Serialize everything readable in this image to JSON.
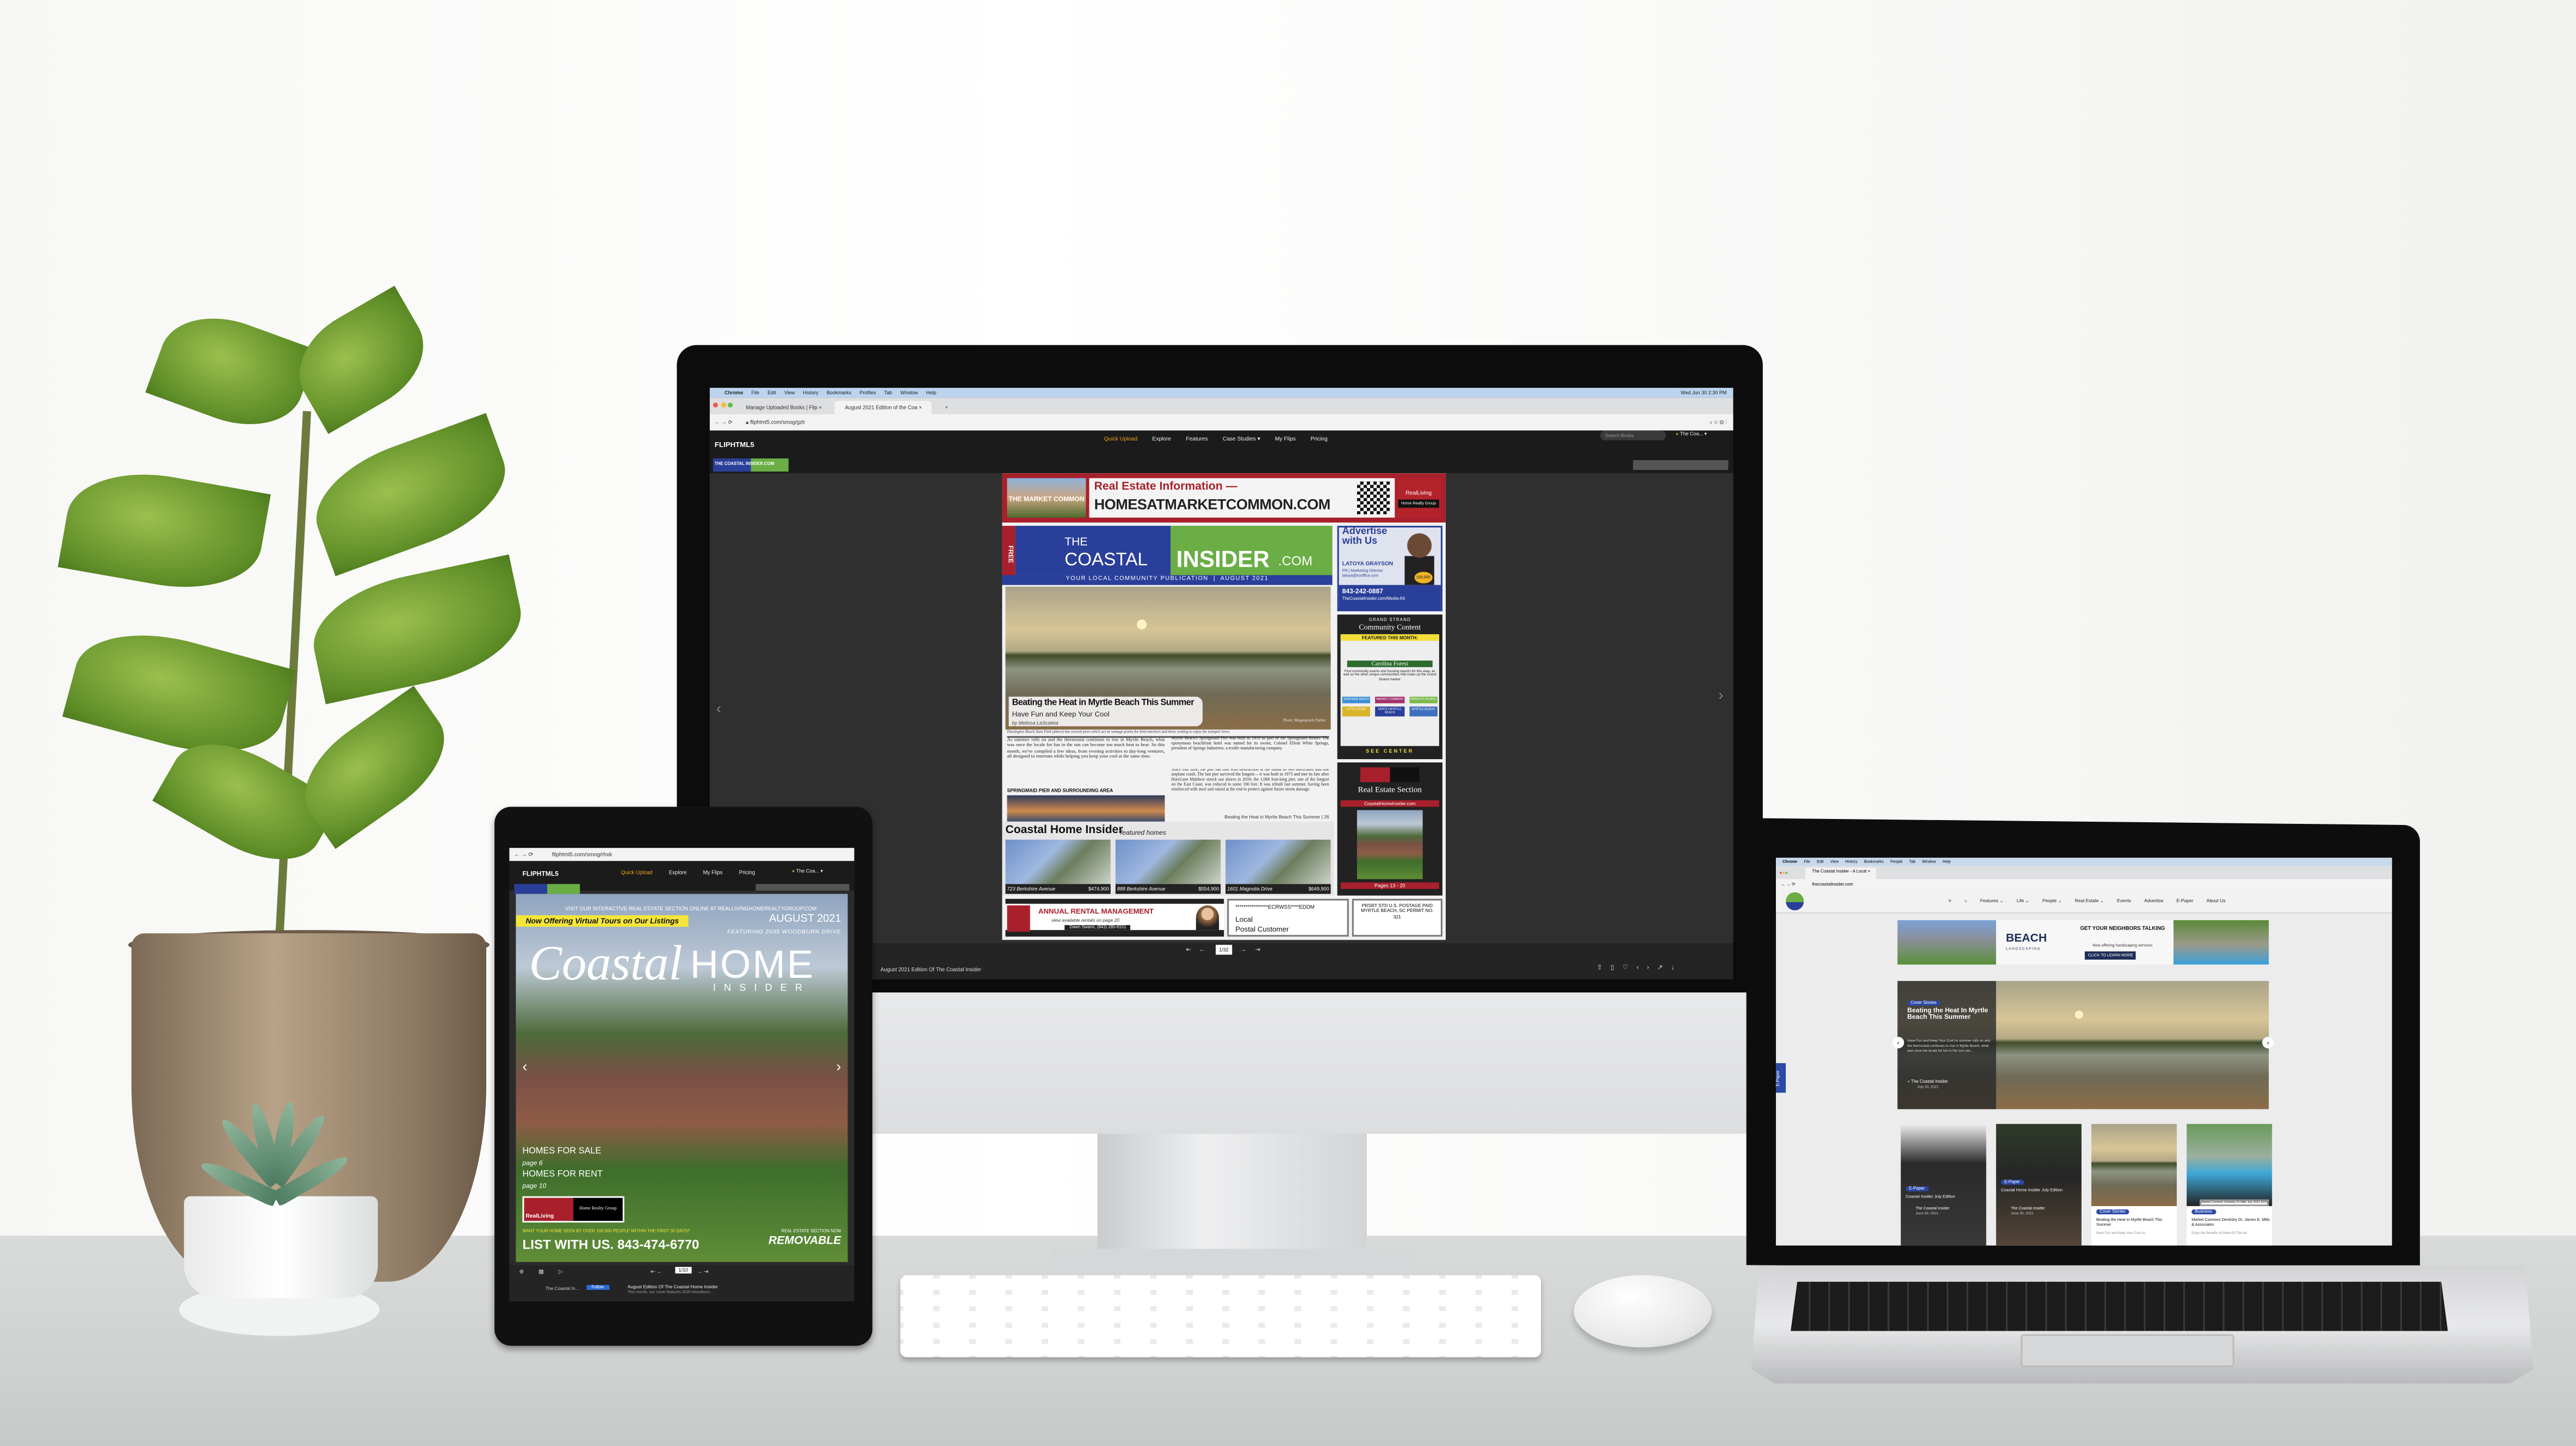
{
  "monitor": {
    "browser": {
      "menu": [
        "Chrome",
        "File",
        "Edit",
        "View",
        "History",
        "Bookmarks",
        "Profiles",
        "Tab",
        "Window",
        "Help"
      ],
      "clock": "Wed Jun 30 2:30 PM",
      "tabs": [
        "Manage Uploaded Books | Flip",
        "August 2021 Edition of the Coa"
      ],
      "url": "fliphtml5.com/smog/gzlr"
    },
    "site": {
      "logo": "FLIPHTML5",
      "nav": [
        "Quick Upload",
        "Explore",
        "Features",
        "Case Studies ▾",
        "My Flips",
        "Pricing"
      ],
      "search_placeholder": "Search Books",
      "user": "The Coa...",
      "brand_logo": "THE COASTAL INSIDER.COM"
    },
    "magazine": {
      "top_ad": {
        "logo": "THE MARKET COMMON",
        "line1": "Real Estate Information —",
        "line2": "HOMESATMARKETCOMMON.COM",
        "brand": "RealLiving",
        "brand_sub": "Home Realty Group"
      },
      "free": "FREE",
      "masthead_the": "THE",
      "masthead_coastal": "COASTAL",
      "masthead_insider": "INSIDER",
      "masthead_com": ".COM",
      "tagline": "YOUR LOCAL COMMUNITY PUBLICATION  |  AUGUST 2021",
      "advertise": {
        "title": "Advertise with Us",
        "name": "LATOYA GRAYSON",
        "role": "PR | Marketing Director",
        "email": "latoya@tcioffice.com",
        "phone": "843-242-0887",
        "url": "TheCoastalInsider.com/Media-Kit",
        "badge": "100,000"
      },
      "community": {
        "kicker": "GRAND STRAND",
        "title": "Community Content",
        "featured": "FEATURED THIS MONTH:",
        "area": "Carolina Forest",
        "desc": "Find community events and housing reports for this area, as well as the other unique communities that make up the Grand Strand market:",
        "towns": [
          "SURFSIDE BEACH",
          "MARKET COMMON",
          "PAWLEYS ISLAND",
          "LITTLE RIVER",
          "NORTH MYRTLE BEACH",
          "MYRTLE BEACH"
        ],
        "see": "SEE CENTER"
      },
      "re_section": {
        "title": "Real Estate Section",
        "url": "CoastalHomeInsider.com",
        "pages": "Pages 13 - 20"
      },
      "story": {
        "title": "Beating the Heat in Myrtle Beach This Summer",
        "subtitle": "Have Fun and Keep Your Cool",
        "byline": "by Melissa LaScaleia",
        "credit": "Photo: Meganpixels Parker",
        "caption": "Huntington Beach State Park (above) has several piers which act as vantage points for bird-watchers and those seeking to enjoy the tranquil views."
      },
      "col1": "As summer rolls on and the thermostat continues to rise in Myrtle Beach, what was once the locale for fun in the sun can become too much heat to bear. So this month, we've compiled a few ideas, from evening activities to day-long ventures, all designed to entertain while helping you keep your cool at the same time.",
      "sub_heading": "SPRINGMAID PIER AND SURROUNDING AREA",
      "col2a": "Myrtle Beach's Springmaid Pier was built in 1953 as part of the Springmaid Resort. The eponymous beachfront hotel was named for its owner, Colonel Elliott White Springs, president of Springs Industries, a textile manufacturing company.",
      "col2b": "Since that time, the pier has met with destruction at the hands of two hurricanes and one airplane crash. The last pier survived the longest— it was built in 1973 and met its fate after Hurricane Matthew struck our shores in 2016; the 1,068 foot-long pier, one of the longest on the East Coast, was reduced to some 100 feet. It was rebuilt last summer, having been reinforced with steel and raised at the end to protect against future storm damage.",
      "jump": "Beating the Heat in Myrtle Beach This Summer | 26",
      "homes_title": "Coastal Home Insider",
      "homes_sub": "featured homes",
      "homes": [
        {
          "address": "723 Berkshire Avenue",
          "price": "$474,900"
        },
        {
          "address": "888 Berkshire Avenue",
          "price": "$554,900"
        },
        {
          "address": "1601 Magnolia Drive",
          "price": "$649,900"
        }
      ],
      "rental": {
        "title": "ANNUAL RENTAL MANAGEMENT",
        "sub": "view available rentals on page 20",
        "contact": "Dawn Swann, (843) 285-6151"
      },
      "mailing": {
        "code": "****************ECRWSS****EDDM",
        "line1": "Local",
        "line2": "Postal Customer"
      },
      "postage": "PRSRT STD U.S. POSTAGE PAID MYRTLE BEACH, SC PERMIT NO. 321"
    },
    "viewer": {
      "page": "1/32",
      "title": "August 2021 Edition Of The Coastal Insider"
    }
  },
  "tablet": {
    "url": "fliphtml5.com/smog/rhxk",
    "logo": "FLIPHTML5",
    "nav": [
      "Quick Upload",
      "Explore",
      "My Flips",
      "Pricing"
    ],
    "user": "The Coa...",
    "cover": {
      "visit": "VISIT OUR INTERACTIVE REAL ESTATE SECTION ONLINE AT REALLIVINGHOMEREALTYGROUP.COM",
      "banner": "Now Offering Virtual Tours on Our Listings",
      "date": "AUGUST 2021",
      "featuring": "FEATURING 2035 WOODBURN DRIVE",
      "title_script": "Coastal",
      "title_home": "HOME",
      "title_insider": "INSIDER",
      "sale": "HOMES FOR SALE",
      "sale_page": "page 6",
      "rent": "HOMES FOR RENT",
      "rent_page": "page 10",
      "brand": "RealLiving",
      "brand_sub": "Home Realty Group",
      "want": "WANT YOUR HOME SEEN BY OVER 100,000 PEOPLE WITHIN THE FIRST 30 DAYS?",
      "list": "LIST WITH US. 843-474-6770",
      "removable_kicker": "REAL ESTATE SECTION NOW",
      "removable": "REMOVABLE"
    },
    "page": "1/10",
    "publisher": "The Coastal In...",
    "follow": "Follow",
    "title": "August Edition Of The Coastal Home Insider",
    "desc": "This month, our cover features 2035 Woodburn..."
  },
  "laptop": {
    "menu": [
      "Chrome",
      "File",
      "Edit",
      "View",
      "History",
      "Bookmarks",
      "People",
      "Tab",
      "Window",
      "Help"
    ],
    "tab": "The Coastal Insider - A Local",
    "url": "thecoastalinsider.com",
    "nav": [
      "Features ⌄",
      "Life ⌄",
      "People ⌄",
      "Real Estate ⌄",
      "Events",
      "Advertise",
      "E-Paper",
      "About Us"
    ],
    "ad": {
      "brand": "BEACH",
      "brand_sub": "LANDSCAPING",
      "headline": "GET YOUR NEIGHBORS TALKING",
      "sub": "Now offering hardscaping services",
      "cta": "CLICK TO LEARN MORE"
    },
    "hero": {
      "category": "Cover Stories",
      "title": "Beating the Heat In Myrtle Beach This Summer",
      "excerpt": "Have Fun and Keep Your Cool As summer rolls on and the thermostat continues to rise in Myrtle Beach, what was once the locale for fun in the sun can...",
      "author": "The Coastal Insider",
      "date": "July 30, 2021"
    },
    "side_tab": "E-Paper",
    "cards": [
      {
        "category": "E-Paper",
        "title": "Coastal Insider July Edition",
        "author": "The Coastal Insider",
        "date": "June 30, 2021"
      },
      {
        "category": "E-Paper",
        "title": "Coastal Home Insider July Edition",
        "author": "The Coastal Insider",
        "date": "June 30, 2021"
      },
      {
        "category": "Cover Stories",
        "title": "Beating the Heat In Myrtle Beach This Summer",
        "excerpt": "Have Fun and Keep Your Cool As"
      },
      {
        "category": "Business",
        "title": "Market Common Dentistry Dr. James E. Mills & Associates",
        "excerpt": "Enjoy the Benefits of State-Of-The-Art",
        "tooltip": "Market Common Dentistry Dr Mills July 2021-4241"
      }
    ]
  },
  "colors": {
    "brand_red": "#a8202b",
    "insider_blue": "#2a3f9a",
    "insider_green": "#6aae45",
    "flip_orange": "#f0a020"
  }
}
